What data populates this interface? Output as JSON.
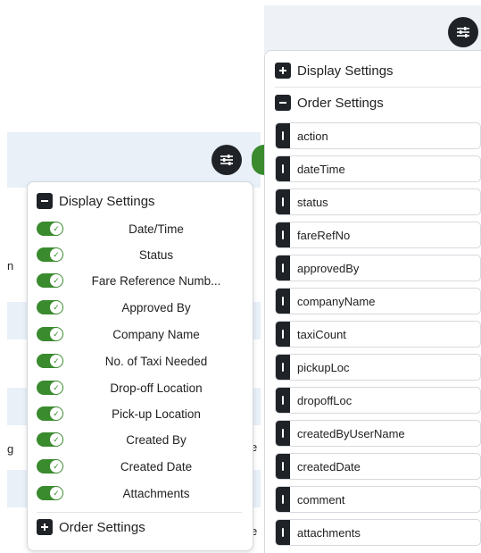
{
  "left": {
    "peek_texts": [
      "n",
      "g",
      "e",
      "e"
    ],
    "display_settings": {
      "title": "Display Settings",
      "state_icon": "minus-icon",
      "items": [
        {
          "label": "Date/Time",
          "on": true
        },
        {
          "label": "Status",
          "on": true
        },
        {
          "label": "Fare Reference Numb...",
          "on": true
        },
        {
          "label": "Approved By",
          "on": true
        },
        {
          "label": "Company Name",
          "on": true
        },
        {
          "label": "No. of Taxi Needed",
          "on": true
        },
        {
          "label": "Drop-off Location",
          "on": true
        },
        {
          "label": "Pick-up Location",
          "on": true
        },
        {
          "label": "Created By",
          "on": true
        },
        {
          "label": "Created Date",
          "on": true
        },
        {
          "label": "Attachments",
          "on": true
        }
      ]
    },
    "order_settings": {
      "title": "Order Settings",
      "state_icon": "plus-icon"
    }
  },
  "right": {
    "display_settings": {
      "title": "Display Settings",
      "state_icon": "plus-icon"
    },
    "order_settings": {
      "title": "Order Settings",
      "state_icon": "minus-icon",
      "items": [
        "action",
        "dateTime",
        "status",
        "fareRefNo",
        "approvedBy",
        "companyName",
        "taxiCount",
        "pickupLoc",
        "dropoffLoc",
        "createdByUserName",
        "createdDate",
        "comment",
        "attachments"
      ]
    }
  },
  "colors": {
    "accent_green": "#3a8a2e",
    "dark": "#1f2328",
    "header_bg": "#e9f0f8",
    "border": "#d6d9dd"
  }
}
